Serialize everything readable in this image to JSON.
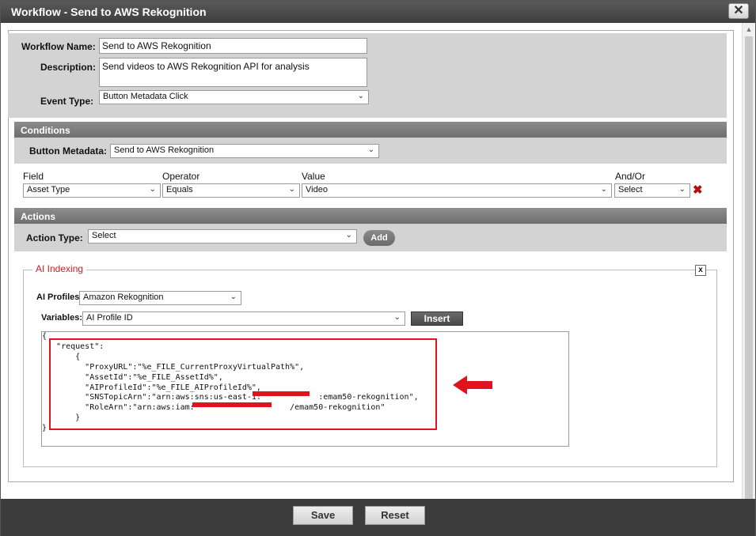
{
  "window": {
    "title": "Workflow - Send to AWS Rekognition",
    "close_label": "✕"
  },
  "workflow": {
    "name_label": "Workflow Name:",
    "name_value": "Send to AWS Rekognition",
    "description_label": "Description:",
    "description_value": "Send videos to AWS Rekognition API for analysis",
    "event_type_label": "Event Type:",
    "event_type_value": "Button Metadata Click"
  },
  "conditions": {
    "header": "Conditions",
    "button_metadata_label": "Button Metadata:",
    "button_metadata_value": "Send to AWS Rekognition",
    "columns": {
      "field": "Field",
      "operator": "Operator",
      "value": "Value",
      "and_or": "And/Or"
    },
    "row": {
      "field": "Asset Type",
      "operator": "Equals",
      "value": "Video",
      "and_or": "Select"
    }
  },
  "actions": {
    "header": "Actions",
    "action_type_label": "Action Type:",
    "action_type_value": "Select",
    "add_label": "Add"
  },
  "ai_indexing": {
    "legend": "AI Indexing",
    "close_label": "x",
    "profiles_label": "AI Profiles",
    "profiles_value": "Amazon Rekognition",
    "variables_label": "Variables:",
    "variables_value": "AI Profile ID",
    "insert_label": "Insert",
    "code_lines": [
      "{",
      "   \"request\":",
      "       {",
      "         \"ProxyURL\":\"%e_FILE_CurrentProxyVirtualPath%\",",
      "         \"AssetId\":\"%e_FILE_AssetId%\",",
      "         \"AIProfileId\":\"%e_FILE_AIProfileId%\",",
      "         \"SNSTopicArn\":\"arn:aws:sns:us-east-1:            :emam50-rekognition\",",
      "         \"RoleArn\":\"arn:aws:iam:                    /emam50-rekognition\"",
      "       }",
      "}"
    ]
  },
  "footer": {
    "save_label": "Save",
    "reset_label": "Reset"
  },
  "colors": {
    "highlight": "#e0141e",
    "legend": "#c81e1e",
    "header_bg": "#7a7a7a",
    "footer_bg": "#3c3c3c"
  }
}
